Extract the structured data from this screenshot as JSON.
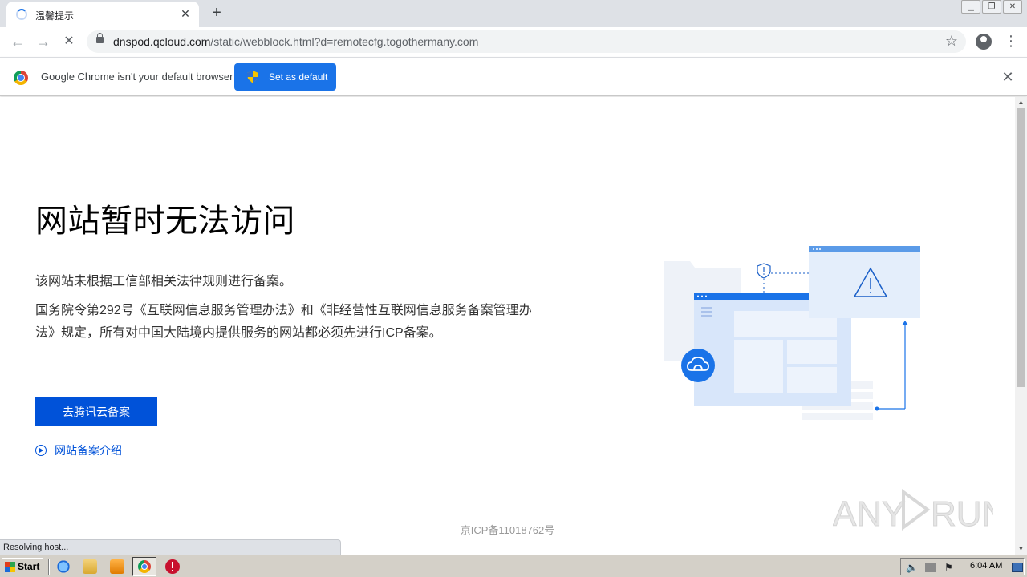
{
  "browser": {
    "tab_title": "温馨提示",
    "url_host": "dnspod.qcloud.com",
    "url_path": "/static/webblock.html?d=remotecfg.togothermany.com"
  },
  "infobar": {
    "message": "Google Chrome isn't your default browser",
    "set_default_label": "Set as default"
  },
  "page": {
    "headline": "网站暂时无法访问",
    "paragraph_1": "该网站未根据工信部相关法律规则进行备案。",
    "paragraph_2": "国务院令第292号《互联网信息服务管理办法》和《非经营性互联网信息服务备案管理办法》规定，所有对中国大陆境内提供服务的网站都必须先进行ICP备案。",
    "cta_label": "去腾讯云备案",
    "intro_link": "网站备案介绍",
    "icp_number": "京ICP备11018762号"
  },
  "status_text": "Resolving host...",
  "taskbar": {
    "start_label": "Start",
    "clock": "6:04 AM"
  },
  "watermark": "ANY RUN",
  "colors": {
    "brand_blue": "#0052d9",
    "chrome_blue": "#1a73e8"
  }
}
